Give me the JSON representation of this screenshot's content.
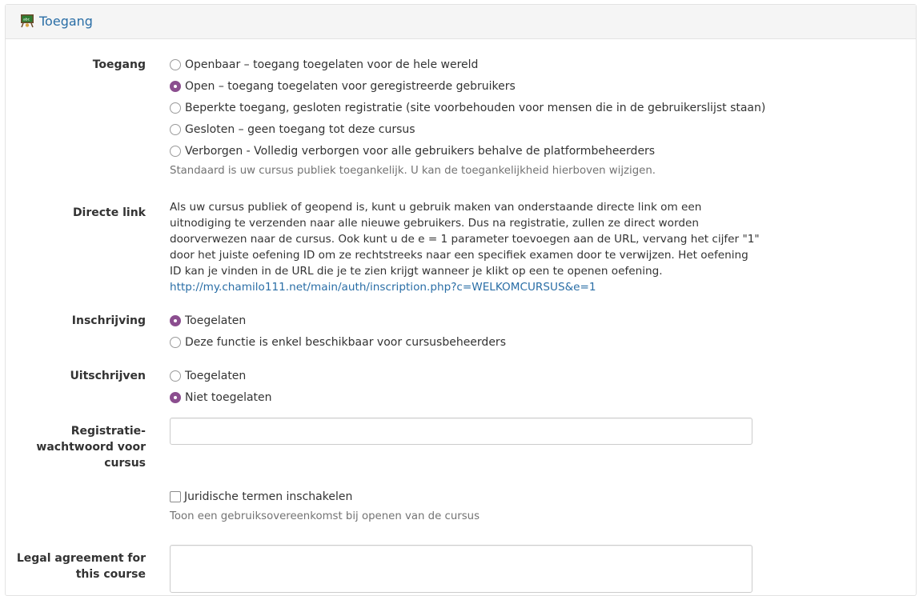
{
  "panel": {
    "title": "Toegang",
    "icon": "school-board-icon"
  },
  "access": {
    "label": "Toegang",
    "options": [
      {
        "label": "Openbaar – toegang toegelaten voor de hele wereld",
        "checked": false
      },
      {
        "label": "Open – toegang toegelaten voor geregistreerde gebruikers",
        "checked": true
      },
      {
        "label": "Beperkte toegang, gesloten registratie (site voorbehouden voor mensen die in de gebruikerslijst staan)",
        "checked": false
      },
      {
        "label": "Gesloten – geen toegang tot deze cursus",
        "checked": false
      },
      {
        "label": "Verborgen - Volledig verborgen voor alle gebruikers behalve de platformbeheerders",
        "checked": false
      }
    ],
    "help": "Standaard is uw cursus publiek toegankelijk. U kan de toegankelijkheid hierboven wijzigen."
  },
  "direct_link": {
    "label": "Directe link",
    "text": "Als uw cursus publiek of geopend is, kunt u gebruik maken van onderstaande directe link om een uitnodiging te verzenden naar alle nieuwe gebruikers. Dus na registratie, zullen ze direct worden doorverwezen naar de cursus. Ook kunt u de e = 1 parameter toevoegen aan de URL, vervang het cijfer \"1\" door het juiste oefening ID om ze rechtstreeks naar een specifiek examen door te verwijzen. Het oefening ID kan je vinden in de URL die je te zien krijgt wanneer je klikt op een te openen oefening.",
    "url": "http://my.chamilo111.net/main/auth/inscription.php?c=WELKOMCURSUS&e=1"
  },
  "subscription": {
    "label": "Inschrijving",
    "options": [
      {
        "label": "Toegelaten",
        "checked": true
      },
      {
        "label": "Deze functie is enkel beschikbaar voor cursusbeheerders",
        "checked": false
      }
    ]
  },
  "unsubscribe": {
    "label": "Uitschrijven",
    "options": [
      {
        "label": "Toegelaten",
        "checked": false
      },
      {
        "label": "Niet toegelaten",
        "checked": true
      }
    ]
  },
  "registration_password": {
    "label_line1": "Registratie-",
    "label_line2": "wachtwoord voor",
    "label_line3": "cursus",
    "value": ""
  },
  "legal_terms": {
    "checkbox_label": "Juridische termen inschakelen",
    "checked": false,
    "help": "Toon een gebruiksovereenkomst bij openen van de cursus"
  },
  "legal_agreement": {
    "label_line1": "Legal agreement for",
    "label_line2": "this course",
    "value": ""
  },
  "colors": {
    "accent": "#8b4e8f",
    "link": "#2a6ea6"
  }
}
